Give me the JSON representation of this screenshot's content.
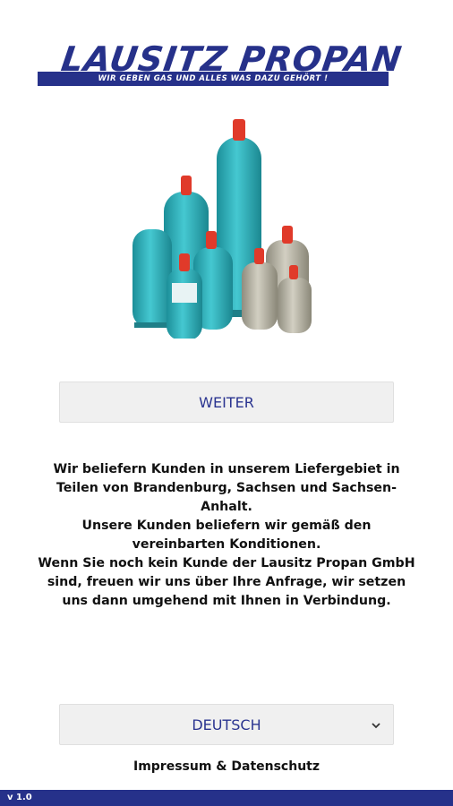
{
  "logo": {
    "title": "LAUSITZ PROPAN",
    "tagline": "WIR GEBEN GAS UND ALLES WAS DAZU GEHÖRT !"
  },
  "buttons": {
    "weiter": "WEITER"
  },
  "info": {
    "lines": [
      "Wir beliefern Kunden in unserem Liefergebiet in Teilen von Brandenburg, Sachsen und Sachsen-Anhalt.",
      "Unsere Kunden beliefern wir gemäß den vereinbarten Konditionen.",
      "Wenn Sie noch kein Kunde der Lausitz Propan GmbH sind, freuen wir uns über Ihre Anfrage, wir setzen uns dann umgehend mit Ihnen in Verbindung."
    ]
  },
  "language": {
    "selected": "DEUTSCH"
  },
  "links": {
    "impressum": "Impressum & Datenschutz"
  },
  "footer": {
    "version": "v 1.0"
  },
  "colors": {
    "brand": "#26318a",
    "button_bg": "#f0f0f0",
    "teal": "#2ab3bd",
    "gray_cylinder": "#b8b5a6",
    "valve_red": "#e03a2a"
  }
}
